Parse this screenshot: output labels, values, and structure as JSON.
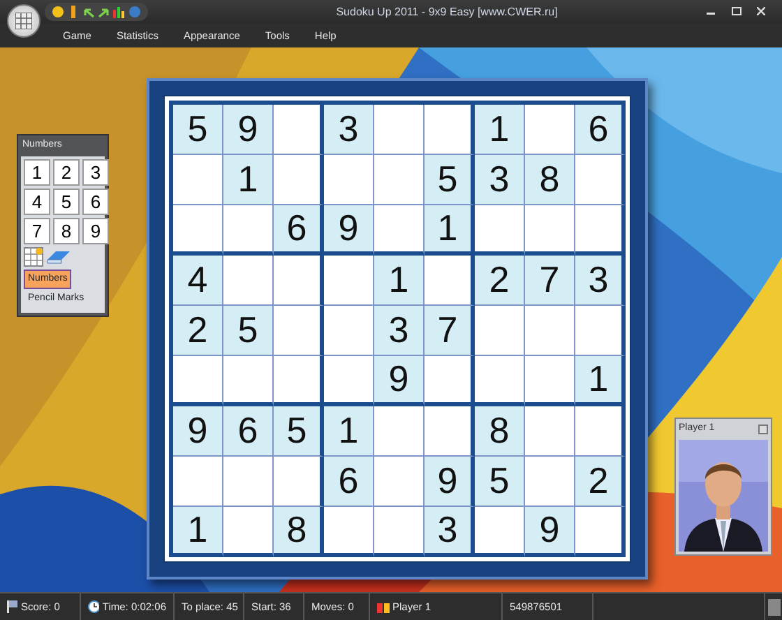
{
  "window": {
    "title": "Sudoku Up 2011 - 9x9 Easy  [www.CWER.ru]"
  },
  "menu": [
    "Game",
    "Statistics",
    "Appearance",
    "Tools",
    "Help"
  ],
  "numbers_panel": {
    "title": "Numbers",
    "digits": [
      "1",
      "2",
      "3",
      "4",
      "5",
      "6",
      "7",
      "8",
      "9"
    ],
    "modes": [
      {
        "label": "Numbers",
        "selected": true
      },
      {
        "label": "Pencil Marks",
        "selected": false
      }
    ]
  },
  "board": [
    [
      {
        "given": true,
        "value": "5"
      },
      {
        "given": true,
        "value": "9"
      },
      {
        "given": false
      },
      {
        "given": true,
        "value": "3"
      },
      {
        "given": false
      },
      {
        "given": false
      },
      {
        "given": true,
        "value": "1"
      },
      {
        "given": false
      },
      {
        "given": true,
        "value": "6"
      }
    ],
    [
      {
        "given": false
      },
      {
        "given": true,
        "value": "1"
      },
      {
        "given": false
      },
      {
        "given": false
      },
      {
        "given": false
      },
      {
        "given": true,
        "value": "5"
      },
      {
        "given": true,
        "value": "3"
      },
      {
        "given": true,
        "value": "8"
      },
      {
        "given": false
      }
    ],
    [
      {
        "given": false
      },
      {
        "given": false
      },
      {
        "given": true,
        "value": "6"
      },
      {
        "given": true,
        "value": "9"
      },
      {
        "given": false
      },
      {
        "given": true,
        "value": "1"
      },
      {
        "given": false
      },
      {
        "given": false
      },
      {
        "given": false
      }
    ],
    [
      {
        "given": true,
        "value": "4"
      },
      {
        "given": false
      },
      {
        "given": false
      },
      {
        "given": false
      },
      {
        "given": true,
        "value": "1"
      },
      {
        "given": false
      },
      {
        "given": true,
        "value": "2"
      },
      {
        "given": true,
        "value": "7"
      },
      {
        "given": true,
        "value": "3"
      }
    ],
    [
      {
        "given": true,
        "value": "2"
      },
      {
        "given": true,
        "value": "5"
      },
      {
        "given": false
      },
      {
        "given": false
      },
      {
        "given": true,
        "value": "3"
      },
      {
        "given": true,
        "value": "7"
      },
      {
        "given": false
      },
      {
        "given": false
      },
      {
        "given": false
      }
    ],
    [
      {
        "given": false
      },
      {
        "given": false
      },
      {
        "given": false
      },
      {
        "given": false
      },
      {
        "given": true,
        "value": "9"
      },
      {
        "given": false
      },
      {
        "given": false
      },
      {
        "given": false
      },
      {
        "given": true,
        "value": "1"
      }
    ],
    [
      {
        "given": true,
        "value": "9"
      },
      {
        "given": true,
        "value": "6"
      },
      {
        "given": true,
        "value": "5"
      },
      {
        "given": true,
        "value": "1"
      },
      {
        "given": false
      },
      {
        "given": false
      },
      {
        "given": true,
        "value": "8"
      },
      {
        "given": false
      },
      {
        "given": false
      }
    ],
    [
      {
        "given": false
      },
      {
        "given": false
      },
      {
        "given": false
      },
      {
        "given": true,
        "value": "6"
      },
      {
        "given": false
      },
      {
        "given": true,
        "value": "9"
      },
      {
        "given": true,
        "value": "5"
      },
      {
        "given": false
      },
      {
        "given": true,
        "value": "2"
      }
    ],
    [
      {
        "given": true,
        "value": "1"
      },
      {
        "given": false
      },
      {
        "given": true,
        "value": "8"
      },
      {
        "given": false
      },
      {
        "given": false
      },
      {
        "given": true,
        "value": "3"
      },
      {
        "given": false
      },
      {
        "given": true,
        "value": "9"
      },
      {
        "given": false
      }
    ]
  ],
  "player_panel": {
    "title": "Player 1"
  },
  "status_bar": [
    {
      "kind": "score",
      "text": "Score: 0"
    },
    {
      "kind": "time",
      "text": "Time: 0:02:06"
    },
    {
      "kind": "plain",
      "text": "To place: 45"
    },
    {
      "kind": "plain",
      "text": "Start: 36"
    },
    {
      "kind": "plain",
      "text": "Moves: 0"
    },
    {
      "kind": "player",
      "text": "Player 1"
    },
    {
      "kind": "plain",
      "text": "549876501"
    }
  ]
}
